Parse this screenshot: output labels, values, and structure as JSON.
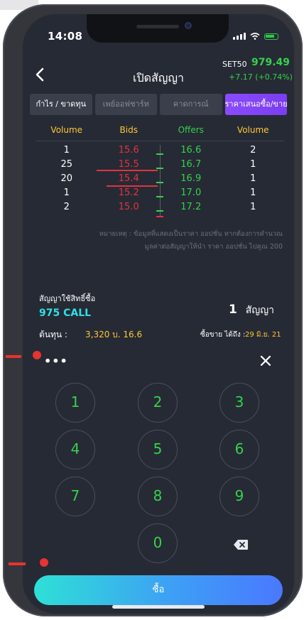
{
  "status_bar": {
    "time": "14:08"
  },
  "header": {
    "title": "เปิดสัญญา",
    "index_name": "SET50",
    "index_value": "979.49",
    "index_change": "+7.17 (+0.74%)"
  },
  "tabs": [
    {
      "label": "กำไร / ขาดทุน"
    },
    {
      "label": "เพย์ออฟชาร์ท"
    },
    {
      "label": "คาดการณ์"
    },
    {
      "label": "ราคาเสนอซื้อ/ขาย"
    }
  ],
  "orderbook": {
    "headers": {
      "volume_left": "Volume",
      "bids": "Bids",
      "offers": "Offers",
      "volume_right": "Volume"
    },
    "rows": [
      {
        "bid_vol": "1",
        "bid": "15.6",
        "offer": "16.6",
        "offer_vol": "2"
      },
      {
        "bid_vol": "25",
        "bid": "15.5",
        "offer": "16.7",
        "offer_vol": "1"
      },
      {
        "bid_vol": "20",
        "bid": "15.4",
        "offer": "16.9",
        "offer_vol": "1"
      },
      {
        "bid_vol": "1",
        "bid": "15.2",
        "offer": "17.0",
        "offer_vol": "1"
      },
      {
        "bid_vol": "2",
        "bid": "15.0",
        "offer": "17.2",
        "offer_vol": "1"
      }
    ]
  },
  "note": {
    "line1": "หมายเหตุ : ข้อมูลที่แสดงเป็นราคา ออปชั่น หากต้องการคำนวณ",
    "line2": "มูลค่าต่อสัญญาให้นำ ราคา ออปชั่น ไปคูณ 200"
  },
  "contract": {
    "label": "สัญญาใช้สิทธิ์ซื้อ",
    "name": "975 CALL",
    "qty_number": "1",
    "qty_unit": "สัญญา",
    "cost_label": "ต้นทุน :",
    "cost_value": "3,320 บ.  16.6",
    "expiry_label": "ซื้อขาย ได้ถึง :",
    "expiry_value": "29 มิ.ย. 21"
  },
  "keypad": {
    "dots": "•••",
    "keys": [
      "1",
      "2",
      "3",
      "4",
      "5",
      "6",
      "7",
      "8",
      "9",
      "0"
    ]
  },
  "action": {
    "buy_label": "ซื้อ"
  },
  "colors": {
    "bid": "#e0343e",
    "offer": "#35d24a",
    "accent_yellow": "#ffc733",
    "contract_cyan": "#2fe0e6",
    "active_tab": "#8b4bff"
  }
}
